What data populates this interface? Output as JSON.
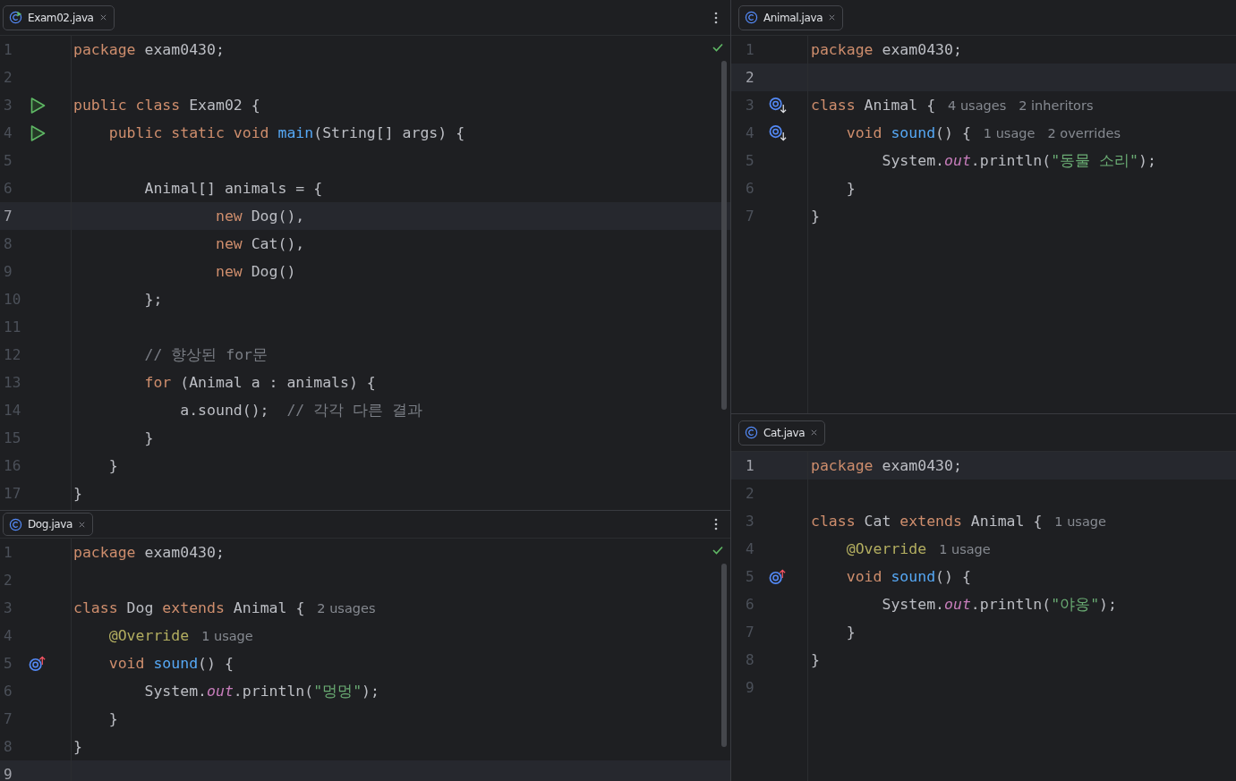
{
  "columns": [
    {
      "panes": [
        {
          "tab": {
            "name": "Exam02.java",
            "kind": "runnable"
          },
          "menu": true,
          "checked": true,
          "scrollbar": true,
          "lines": [
            {
              "number": "1",
              "current": false,
              "tokens": [
                {
                  "kind": "kw",
                  "text": "package "
                },
                {
                  "kind": "plain",
                  "text": "exam0430;"
                }
              ]
            },
            {
              "number": "2",
              "current": false
            },
            {
              "number": "3",
              "gutter_marker": {
                "kind": "run"
              },
              "current": false,
              "tokens": [
                {
                  "kind": "kw",
                  "text": "public class "
                },
                {
                  "kind": "plain",
                  "text": "Exam02 {"
                }
              ]
            },
            {
              "number": "4",
              "gutter_marker": {
                "kind": "run"
              },
              "current": false,
              "tokens": [
                {
                  "kind": "kw",
                  "text": "    public static void "
                },
                {
                  "kind": "fn",
                  "text": "main"
                },
                {
                  "kind": "plain",
                  "text": "(String[] args) {"
                }
              ]
            },
            {
              "number": "5",
              "current": false
            },
            {
              "number": "6",
              "current": false,
              "tokens": [
                {
                  "kind": "plain",
                  "text": "        Animal[] animals = {"
                }
              ]
            },
            {
              "number": "7",
              "current": true,
              "tokens": [
                {
                  "kind": "kw",
                  "text": "                new "
                },
                {
                  "kind": "plain",
                  "text": "Dog(),"
                }
              ]
            },
            {
              "number": "8",
              "current": false,
              "tokens": [
                {
                  "kind": "kw",
                  "text": "                new "
                },
                {
                  "kind": "plain",
                  "text": "Cat(),"
                }
              ]
            },
            {
              "number": "9",
              "current": false,
              "tokens": [
                {
                  "kind": "kw",
                  "text": "                new "
                },
                {
                  "kind": "plain",
                  "text": "Dog()"
                }
              ]
            },
            {
              "number": "10",
              "current": false,
              "tokens": [
                {
                  "kind": "plain",
                  "text": "        };"
                }
              ]
            },
            {
              "number": "11",
              "current": false
            },
            {
              "number": "12",
              "current": false,
              "tokens": [
                {
                  "kind": "comment",
                  "text": "        // 향상된 for문"
                }
              ]
            },
            {
              "number": "13",
              "current": false,
              "tokens": [
                {
                  "kind": "kw",
                  "text": "        for "
                },
                {
                  "kind": "plain",
                  "text": "(Animal a : animals) {"
                }
              ]
            },
            {
              "number": "14",
              "current": false,
              "tokens": [
                {
                  "kind": "plain",
                  "text": "            a.sound();  "
                },
                {
                  "kind": "comment",
                  "text": "// 각각 다른 결과"
                }
              ]
            },
            {
              "number": "15",
              "current": false,
              "tokens": [
                {
                  "kind": "plain",
                  "text": "        }"
                }
              ]
            },
            {
              "number": "16",
              "current": false,
              "tokens": [
                {
                  "kind": "plain",
                  "text": "    }"
                }
              ]
            },
            {
              "number": "17",
              "current": false,
              "tokens": [
                {
                  "kind": "plain",
                  "text": "}"
                }
              ]
            }
          ]
        },
        {
          "tab": {
            "name": "Dog.java",
            "kind": "class"
          },
          "menu": true,
          "checked": true,
          "scrollbar": true,
          "lines": [
            {
              "number": "1",
              "current": false,
              "tokens": [
                {
                  "kind": "kw",
                  "text": "package "
                },
                {
                  "kind": "plain",
                  "text": "exam0430;"
                }
              ]
            },
            {
              "number": "2",
              "current": false
            },
            {
              "number": "3",
              "current": false,
              "tokens": [
                {
                  "kind": "kw",
                  "text": "class "
                },
                {
                  "kind": "plain",
                  "text": "Dog "
                },
                {
                  "kind": "kw",
                  "text": "extends "
                },
                {
                  "kind": "plain",
                  "text": "Animal {"
                }
              ],
              "hints": [
                "2 usages"
              ]
            },
            {
              "number": "4",
              "current": false,
              "tokens": [
                {
                  "kind": "anno",
                  "text": "    @Override"
                }
              ],
              "hints": [
                "1 usage"
              ]
            },
            {
              "number": "5",
              "gutter_marker": {
                "kind": "override"
              },
              "current": false,
              "tokens": [
                {
                  "kind": "kw",
                  "text": "    void "
                },
                {
                  "kind": "fn",
                  "text": "sound"
                },
                {
                  "kind": "plain",
                  "text": "() {"
                }
              ]
            },
            {
              "number": "6",
              "current": false,
              "tokens": [
                {
                  "kind": "plain",
                  "text": "        System."
                },
                {
                  "kind": "field",
                  "text": "out"
                },
                {
                  "kind": "plain",
                  "text": ".println("
                },
                {
                  "kind": "str",
                  "text": "\"멍멍\""
                },
                {
                  "kind": "plain",
                  "text": ");"
                }
              ]
            },
            {
              "number": "7",
              "current": false,
              "tokens": [
                {
                  "kind": "plain",
                  "text": "    }"
                }
              ]
            },
            {
              "number": "8",
              "current": false,
              "tokens": [
                {
                  "kind": "plain",
                  "text": "}"
                }
              ]
            },
            {
              "number": "9",
              "current": true
            }
          ]
        }
      ]
    },
    {
      "panes": [
        {
          "tab": {
            "name": "Animal.java",
            "kind": "class"
          },
          "lines": [
            {
              "number": "1",
              "current": false,
              "tokens": [
                {
                  "kind": "kw",
                  "text": "package "
                },
                {
                  "kind": "plain",
                  "text": "exam0430;"
                }
              ]
            },
            {
              "number": "2",
              "current": true
            },
            {
              "number": "3",
              "gutter_marker": {
                "kind": "implemented"
              },
              "current": false,
              "tokens": [
                {
                  "kind": "kw",
                  "text": "class "
                },
                {
                  "kind": "plain",
                  "text": "Animal {"
                }
              ],
              "hints": [
                "4 usages",
                "2 inheritors"
              ]
            },
            {
              "number": "4",
              "gutter_marker": {
                "kind": "implemented"
              },
              "current": false,
              "tokens": [
                {
                  "kind": "kw",
                  "text": "    void "
                },
                {
                  "kind": "fn",
                  "text": "sound"
                },
                {
                  "kind": "plain",
                  "text": "() {"
                }
              ],
              "hints": [
                "1 usage",
                "2 overrides"
              ]
            },
            {
              "number": "5",
              "current": false,
              "tokens": [
                {
                  "kind": "plain",
                  "text": "        System."
                },
                {
                  "kind": "field",
                  "text": "out"
                },
                {
                  "kind": "plain",
                  "text": ".println("
                },
                {
                  "kind": "str",
                  "text": "\"동물 소리\""
                },
                {
                  "kind": "plain",
                  "text": ");"
                }
              ]
            },
            {
              "number": "6",
              "current": false,
              "tokens": [
                {
                  "kind": "plain",
                  "text": "    }"
                }
              ]
            },
            {
              "number": "7",
              "current": false,
              "tokens": [
                {
                  "kind": "plain",
                  "text": "}"
                }
              ]
            }
          ]
        },
        {
          "tab": {
            "name": "Cat.java",
            "kind": "class"
          },
          "lines": [
            {
              "number": "1",
              "current": true,
              "tokens": [
                {
                  "kind": "kw",
                  "text": "package "
                },
                {
                  "kind": "plain",
                  "text": "exam0430;"
                }
              ]
            },
            {
              "number": "2",
              "current": false
            },
            {
              "number": "3",
              "current": false,
              "tokens": [
                {
                  "kind": "kw",
                  "text": "class "
                },
                {
                  "kind": "plain",
                  "text": "Cat "
                },
                {
                  "kind": "kw",
                  "text": "extends "
                },
                {
                  "kind": "plain",
                  "text": "Animal {"
                }
              ],
              "hints": [
                "1 usage"
              ]
            },
            {
              "number": "4",
              "current": false,
              "tokens": [
                {
                  "kind": "anno",
                  "text": "    @Override"
                }
              ],
              "hints": [
                "1 usage"
              ]
            },
            {
              "number": "5",
              "gutter_marker": {
                "kind": "override"
              },
              "current": false,
              "tokens": [
                {
                  "kind": "kw",
                  "text": "    void "
                },
                {
                  "kind": "fn",
                  "text": "sound"
                },
                {
                  "kind": "plain",
                  "text": "() {"
                }
              ]
            },
            {
              "number": "6",
              "current": false,
              "tokens": [
                {
                  "kind": "plain",
                  "text": "        System."
                },
                {
                  "kind": "field",
                  "text": "out"
                },
                {
                  "kind": "plain",
                  "text": ".println("
                },
                {
                  "kind": "str",
                  "text": "\"야옹\""
                },
                {
                  "kind": "plain",
                  "text": ");"
                }
              ]
            },
            {
              "number": "7",
              "current": false,
              "tokens": [
                {
                  "kind": "plain",
                  "text": "    }"
                }
              ]
            },
            {
              "number": "8",
              "current": false,
              "tokens": [
                {
                  "kind": "plain",
                  "text": "}"
                }
              ]
            },
            {
              "number": "9",
              "current": false
            }
          ]
        }
      ]
    }
  ]
}
